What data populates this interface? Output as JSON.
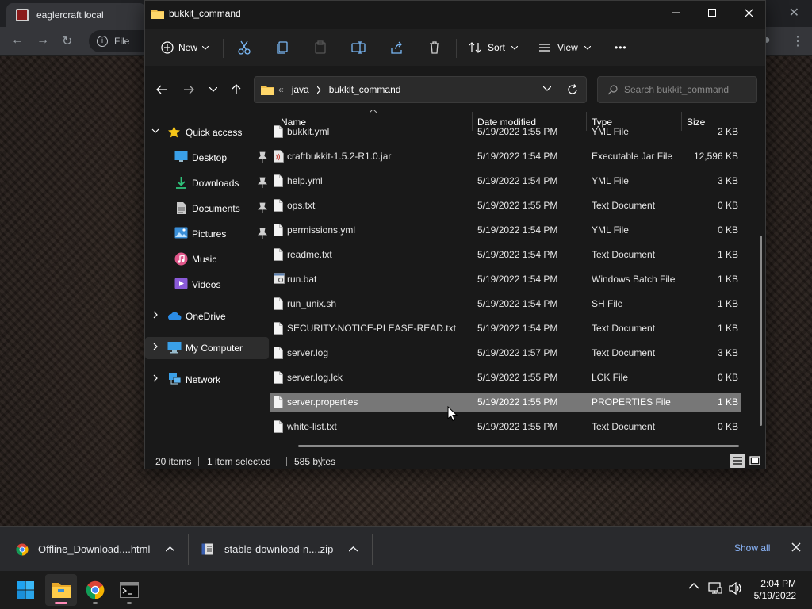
{
  "browser": {
    "tab_title": "eaglercraft local",
    "omnibox_text": "File"
  },
  "window": {
    "title": "bukkit_command",
    "minimize_label": "—",
    "maximize_label": "☐",
    "close_label": "✕"
  },
  "commandbar": {
    "new_label": "New",
    "sort_label": "Sort",
    "view_label": "View",
    "more_label": "•••"
  },
  "address": {
    "overflow": "«",
    "segments": [
      "java",
      "bukkit_command"
    ],
    "search_placeholder": "Search bukkit_command"
  },
  "sidebar": {
    "items": [
      {
        "label": "Quick access",
        "icon": "star-icon"
      },
      {
        "label": "Desktop",
        "icon": "desktop-icon",
        "pinned": true
      },
      {
        "label": "Downloads",
        "icon": "downloads-icon",
        "pinned": true
      },
      {
        "label": "Documents",
        "icon": "documents-icon",
        "pinned": true
      },
      {
        "label": "Pictures",
        "icon": "pictures-icon",
        "pinned": true
      },
      {
        "label": "Music",
        "icon": "music-icon"
      },
      {
        "label": "Videos",
        "icon": "videos-icon"
      },
      {
        "label": "OneDrive",
        "icon": "cloud-icon"
      },
      {
        "label": "My Computer",
        "icon": "computer-icon"
      },
      {
        "label": "Network",
        "icon": "network-icon"
      }
    ]
  },
  "columns": {
    "name": "Name",
    "date": "Date modified",
    "type": "Type",
    "size": "Size"
  },
  "files": [
    {
      "name": "bukkit.yml",
      "date": "5/19/2022 1:55 PM",
      "type": "YML File",
      "size": "2 KB"
    },
    {
      "name": "craftbukkit-1.5.2-R1.0.jar",
      "date": "5/19/2022 1:54 PM",
      "type": "Executable Jar File",
      "size": "12,596 KB"
    },
    {
      "name": "help.yml",
      "date": "5/19/2022 1:54 PM",
      "type": "YML File",
      "size": "3 KB"
    },
    {
      "name": "ops.txt",
      "date": "5/19/2022 1:55 PM",
      "type": "Text Document",
      "size": "0 KB"
    },
    {
      "name": "permissions.yml",
      "date": "5/19/2022 1:54 PM",
      "type": "YML File",
      "size": "0 KB"
    },
    {
      "name": "readme.txt",
      "date": "5/19/2022 1:54 PM",
      "type": "Text Document",
      "size": "1 KB"
    },
    {
      "name": "run.bat",
      "date": "5/19/2022 1:54 PM",
      "type": "Windows Batch File",
      "size": "1 KB"
    },
    {
      "name": "run_unix.sh",
      "date": "5/19/2022 1:54 PM",
      "type": "SH File",
      "size": "1 KB"
    },
    {
      "name": "SECURITY-NOTICE-PLEASE-READ.txt",
      "date": "5/19/2022 1:54 PM",
      "type": "Text Document",
      "size": "1 KB"
    },
    {
      "name": "server.log",
      "date": "5/19/2022 1:57 PM",
      "type": "Text Document",
      "size": "3 KB"
    },
    {
      "name": "server.log.lck",
      "date": "5/19/2022 1:55 PM",
      "type": "LCK File",
      "size": "0 KB"
    },
    {
      "name": "server.properties",
      "date": "5/19/2022 1:55 PM",
      "type": "PROPERTIES File",
      "size": "1 KB",
      "selected": true
    },
    {
      "name": "white-list.txt",
      "date": "5/19/2022 1:55 PM",
      "type": "Text Document",
      "size": "0 KB"
    }
  ],
  "status": {
    "items_count": "20 items",
    "selected": "1 item selected",
    "size": "585 bytes"
  },
  "downloads": {
    "items": [
      {
        "name": "Offline_Download....html"
      },
      {
        "name": "stable-download-n....zip"
      }
    ],
    "show_all": "Show all"
  },
  "taskbar": {
    "time": "2:04 PM",
    "date": "5/19/2022"
  },
  "colors": {
    "window_bg": "#191919",
    "selection": "#777777",
    "accent": "#8ab4f8",
    "folder": "#f2c14e"
  }
}
